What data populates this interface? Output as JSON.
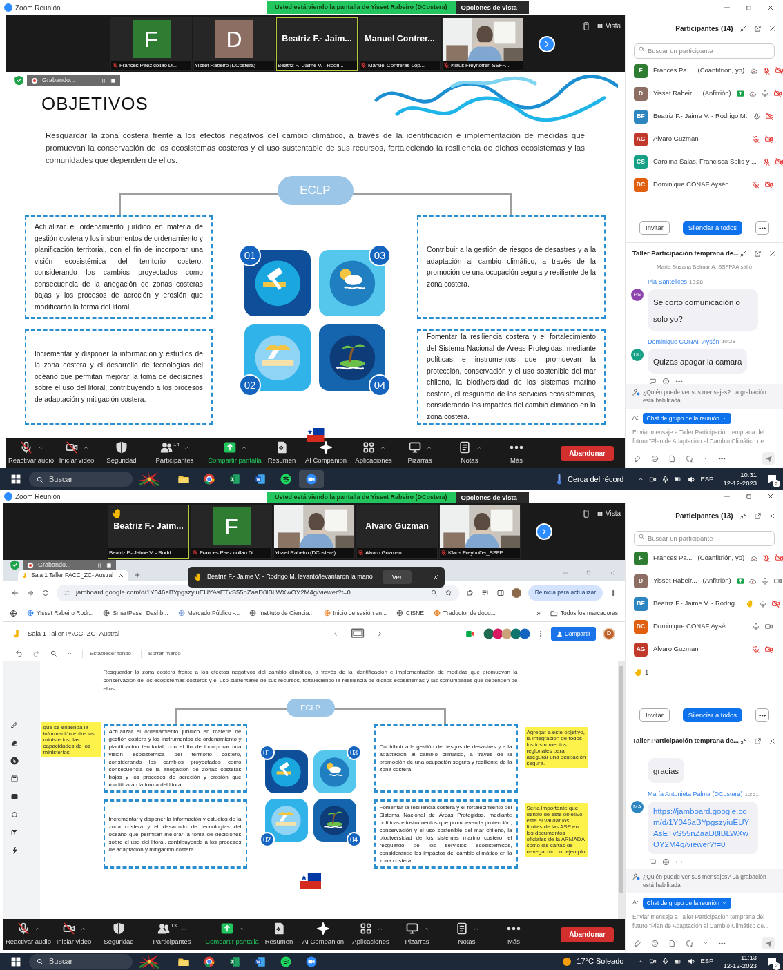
{
  "screens": [
    {
      "window": {
        "title": "Zoom Reunión"
      },
      "share_banner": {
        "text": "Usted está viendo la pantalla de Yisset Rabeiro (DCostera)",
        "view_options": "Opciones de vista"
      },
      "view_button": "Vista",
      "video_tiles": [
        {
          "kind": "avatar",
          "letter": "F",
          "color": "#2e7d32",
          "caption": "Frances Paez collao Di...",
          "muted": true,
          "active": false,
          "hand": false
        },
        {
          "kind": "avatar",
          "letter": "D",
          "color": "#8d6e63",
          "caption": "Yisset Rabeiro (DCostera)",
          "muted": false,
          "active": false,
          "hand": false
        },
        {
          "kind": "name",
          "name": "Beatriz F.- Jaim...",
          "caption": "Beatriz F.- Jaime V. - Rodri...",
          "muted": false,
          "active": true,
          "hand": false
        },
        {
          "kind": "name",
          "name": "Manuel Contrer...",
          "caption": "Manuel Contreras-Lop...",
          "muted": true,
          "active": false,
          "hand": false
        },
        {
          "kind": "video",
          "caption": "Klaus Freyhoffer_SSFF...",
          "muted": true,
          "active": false,
          "hand": false
        }
      ],
      "recording": {
        "label": "Grabando..."
      },
      "content": {
        "kind": "slide",
        "slide": {
          "heading": "OBJETIVOS",
          "intro": "Resguardar la zona costera frente a los efectos negativos del cambio climático, a través de la identificación e implementación de medidas que promuevan la conservación de los ecosistemas costeros y el uso sustentable de sus recursos, fortaleciendo la resiliencia de dichos ecosistemas y las comunidades que dependen de ellos.",
          "center_label": "ECLP",
          "objectives": [
            "Actualizar el ordenamiento jurídico en materia de gestión costera y los instrumentos de ordenamiento y planificación territorial, con el fin de incorporar una visión ecosistémica del territorio costero, considerando los cambios proyectados como consecuencia de la anegación de zonas costeras bajas y los procesos de acreción y erosión que modificarán la forma del litoral.",
            "Contribuir a la gestión de riesgos de desastres y a la adaptación al cambio climático, a través de la promoción de una ocupación segura y resiliente de la zona costera.",
            "Incrementar y disponer la información y estudios de la zona costera y el desarrollo de tecnologías del océano que permitan mejorar la toma de decisiones sobre el uso del litoral, contribuyendo a los procesos de adaptación y mitigación costera.",
            "Fomentar la resiliencia costera y el fortalecimiento del Sistema Nacional de Áreas Protegidas, mediante políticas e instrumentos que promuevan la protección, conservación y el uso sostenible del mar chileno, la biodiversidad de los sistemas marino costero, el resguardo de los servicios ecosistémicos, considerando los impactos del cambio climático en la zona costera."
          ],
          "tile_numbers": [
            "01",
            "03",
            "02",
            "04"
          ]
        }
      },
      "participants": {
        "title": "Participantes (14)",
        "search": {
          "placeholder": "Buscar un participante"
        },
        "items": [
          {
            "initials": "F",
            "color": "#2e7d32",
            "name": "Frances Pa...",
            "role": "(Coanfitrión, yo)",
            "sharing": false,
            "recording": true,
            "hand": false,
            "muted": true,
            "video_off": true
          },
          {
            "initials": "D",
            "color": "#8d6e63",
            "name": "Yisset Rabeir...",
            "role": "(Anfitrión)",
            "sharing": true,
            "recording": true,
            "hand": false,
            "muted": false,
            "video_off": true
          },
          {
            "initials": "BF",
            "color": "#2e86c1",
            "name": "Beatriz F.- Jaime V. - Rodrigo M.",
            "sharing": false,
            "recording": false,
            "hand": false,
            "muted": false,
            "video_off": true
          },
          {
            "initials": "AG",
            "color": "#c0392b",
            "name": "Alvaro Guzman",
            "sharing": false,
            "recording": false,
            "hand": false,
            "muted": true,
            "video_off": true
          },
          {
            "initials": "CS",
            "color": "#16a085",
            "name": "Carolina Salas, Francisca Solís y ...",
            "sharing": false,
            "recording": false,
            "hand": false,
            "muted": true,
            "video_off": true
          },
          {
            "initials": "DC",
            "color": "#e06010",
            "name": "Dominique CONAF Aysén",
            "sharing": false,
            "recording": false,
            "hand": false,
            "muted": true,
            "video_off": true
          }
        ],
        "invite": "Invitar",
        "mute_all": "Silenciar a todos"
      },
      "chat": {
        "title": "Taller Participación temprana de...",
        "messages": [
          {
            "kind": "system",
            "text": "María Susana Belmar A. SSFFAA salió"
          },
          {
            "kind": "text",
            "sender": "Pia Santelices",
            "initials": "PS",
            "color": "#8e44ad",
            "time": "10:28",
            "text": "Se corto comunicación o solo yo?"
          },
          {
            "kind": "text",
            "sender": "Dominique CONAF Aysén",
            "initials": "DC",
            "color": "#16a085",
            "time": "10:28",
            "text": "Quizas apagar la camara"
          }
        ],
        "notice": "¿Quién puede ver sus mensajes? La grabación está habilitada",
        "to_label": "A:",
        "recipient": "Chat de grupo de la reunión",
        "input": {
          "placeholder": "Enviar mensaje a Taller Participación temprana del futuro \"Plan de Adaptación al Cambio Climático de..."
        }
      },
      "toolbar": {
        "items": [
          {
            "kind": "audio",
            "label": "Reactivar audio",
            "off": true,
            "caret": true
          },
          {
            "kind": "video",
            "label": "Iniciar video",
            "off": true,
            "caret": true
          },
          {
            "kind": "security",
            "label": "Seguridad",
            "caret": false
          },
          {
            "kind": "participants",
            "label": "Participantes",
            "count": "14",
            "caret": true
          },
          {
            "kind": "share",
            "label": "Compartir pantalla",
            "caret": true
          },
          {
            "kind": "summary",
            "label": "Resumen",
            "caret": false
          },
          {
            "kind": "ai",
            "label": "AI Companion",
            "caret": false
          },
          {
            "kind": "apps",
            "label": "Aplicaciones",
            "caret": true
          },
          {
            "kind": "whiteboard",
            "label": "Pizarras",
            "caret": true
          },
          {
            "kind": "notes",
            "label": "Notas",
            "caret": true
          },
          {
            "kind": "more",
            "label": "Más",
            "caret": false
          }
        ],
        "leave": "Abandonar"
      },
      "taskbar": {
        "search": "Buscar",
        "apps": [
          {
            "kind": "explorer",
            "active": false
          },
          {
            "kind": "chrome",
            "active": false
          },
          {
            "kind": "excel",
            "active": false
          },
          {
            "kind": "word",
            "active": false
          },
          {
            "kind": "spotify",
            "active": false
          },
          {
            "kind": "zoom",
            "active": true
          }
        ],
        "weather": {
          "kind": "thermometer",
          "text": "Cerca del récord"
        },
        "language": "ESP",
        "time": "10:31",
        "date": "12-12-2023",
        "notifications": "2"
      }
    },
    {
      "window": {
        "title": "Zoom Reunión"
      },
      "share_banner": {
        "text": "Usted está viendo la pantalla de Yisset Rabeiro (DCostera)",
        "view_options": "Opciones de vista"
      },
      "view_button": "Vista",
      "video_tiles": [
        {
          "kind": "name",
          "name": "Beatriz F.- Jaim...",
          "caption": "Beatriz F.- Jaime V. - Rodri...",
          "muted": false,
          "active": true,
          "hand": true
        },
        {
          "kind": "avatar",
          "letter": "F",
          "color": "#2e7d32",
          "caption": "Frances Paez collao Di...",
          "muted": true,
          "active": false,
          "hand": false
        },
        {
          "kind": "video",
          "caption": "Yisset Rabeiro (DCostera)",
          "muted": false,
          "active": false,
          "hand": false
        },
        {
          "kind": "name",
          "name": "Alvaro Guzman",
          "caption": "Alvaro Guzman",
          "muted": true,
          "active": false,
          "hand": false
        },
        {
          "kind": "video",
          "caption": "Klaus Freyhoffer_SSFF...",
          "muted": true,
          "active": false,
          "hand": false
        }
      ],
      "recording": {
        "label": "Grabando..."
      },
      "content": {
        "kind": "browser",
        "tabs": [
          {
            "label": "Sala 1 Taller PACC_ZC- Austral",
            "selected": true
          }
        ],
        "notification": {
          "text": "Beatriz F.- Jaime V. - Rodrigo M. levantó/levantaron la mano",
          "action": "Ver"
        },
        "address": "jamboard.google.com/d/1Y046aBYpgszyiuEUYAsETvS55nZaaD8lBLWXwOY2M4g/viewer?f=0",
        "update_button": "Reinicia para actualizar",
        "bookmarks": [
          "Yisset Rabeiro Rodr...",
          "SmartPass | Dashb...",
          "Mercado Público -...",
          "Instituto de Ciencia...",
          "Inicio de sesión en...",
          "CISNE",
          "Traductor de docu..."
        ],
        "bookmarks_overflow": "»",
        "all_bookmarks": "Todos los marcadores",
        "jamboard": {
          "title": "Sala 1 Taller PACC_ZC- Austral",
          "share_button": "Compartir",
          "account": "D",
          "tools": [
            "Establecer fondo",
            "Borrar marco"
          ]
        },
        "slide": {
          "intro": "Resguardar la zona costera frente a los efectos negativos del cambio climático, a través de la identificación e implementación de medidas que promuevan la conservación de los ecosistemas costeros y el uso sustentable de sus recursos, fortaleciendo la resiliencia de dichos ecosistemas y las comunidades que dependen de ellos.",
          "center_label": "ECLP",
          "objectives": [
            "Actualizar el ordenamiento jurídico en materia de gestión costera y los instrumentos de ordenamiento y planificación territorial, con el fin de incorporar una visión ecosistémica del territorio costero, considerando los cambios proyectados como consecuencia de la anegación de zonas costeras bajas y los procesos de acreción y erosión que modificarán la forma del litoral.",
            "Contribuir a la gestión de riesgos de desastres y a la adaptación al cambio climático, a través de la promoción de una ocupación segura y resiliente de la zona costera.",
            "Incrementar y disponer la información y estudios de la zona costera y el desarrollo de tecnologías del océano que permitan mejorar la toma de decisiones sobre el uso del litoral, contribuyendo a los procesos de adaptación y mitigación costera.",
            "Fomentar la resiliencia costera y el fortalecimiento del Sistema Nacional de Áreas Protegidas, mediante políticas e instrumentos que promuevan la protección, conservación y el uso sostenible del mar chileno, la biodiversidad de los sistemas marino costero, el resguardo de los servicios ecosistémicos, considerando los impactos del cambio climático en la zona costera."
          ],
          "tile_numbers": [
            "01",
            "03",
            "02",
            "04"
          ]
        },
        "sticky_notes": [
          {
            "text": "que se entienda la información entre los ministerios, las capacidades de los ministerios"
          },
          {
            "text": "Agregar a este objetivo, la integración de todos los instrumentos regionales para asegurar una ocupación segura."
          },
          {
            "text": "Sería importante que, dentro de este objetivo esté el validar los límites de las ASP en los documentos oficiales de la ARMADA como las cartas de navegación por ejemplo"
          }
        ]
      },
      "participants": {
        "title": "Participantes (13)",
        "search": {
          "placeholder": "Buscar un participante"
        },
        "items": [
          {
            "initials": "F",
            "color": "#2e7d32",
            "name": "Frances Pa...",
            "role": "(Coanfitrión, yo)",
            "sharing": false,
            "recording": true,
            "hand": false,
            "muted": true,
            "video_off": true
          },
          {
            "initials": "D",
            "color": "#8d6e63",
            "name": "Yisset Rabeir...",
            "role": "(Anfitrión)",
            "sharing": true,
            "recording": true,
            "hand": false,
            "muted": false,
            "video_off": false
          },
          {
            "initials": "BF",
            "color": "#2e86c1",
            "name": "Beatriz F.- Jaime V. - Rodrig...",
            "sharing": false,
            "recording": false,
            "hand": true,
            "muted": false,
            "video_off": true
          },
          {
            "initials": "DC",
            "color": "#e06010",
            "name": "Dominique CONAF Aysén",
            "sharing": false,
            "recording": false,
            "hand": false,
            "muted": false,
            "video_off": false
          },
          {
            "initials": "AG",
            "color": "#c0392b",
            "name": "Alvaro Guzman",
            "sharing": false,
            "recording": false,
            "hand": false,
            "muted": true,
            "video_off": true
          }
        ],
        "raised_hands": "1",
        "invite": "Invitar",
        "mute_all": "Silenciar a todos"
      },
      "chat": {
        "title": "Taller Participación temprana de...",
        "messages": [
          {
            "kind": "text",
            "text": "gracias"
          },
          {
            "kind": "link",
            "sender": "María Antonieta Palma (DCostera)",
            "initials": "MA",
            "color": "#2e86c1",
            "time": "10:51",
            "text": "https://jamboard.google.com/d/1Y046aBYpgszyiuEUYAsETvS55nZaaD8lBLWXwOY2M4g/viewer?f=0"
          }
        ],
        "notice": "¿Quién puede ver sus mensajes? La grabación está habilitada",
        "to_label": "A:",
        "recipient": "Chat de grupo de la reunión",
        "input": {
          "placeholder": "Enviar mensaje a Taller Participación temprana del futuro \"Plan de Adaptación al Cambio Climático de..."
        }
      },
      "toolbar": {
        "items": [
          {
            "kind": "audio",
            "label": "Reactivar audio",
            "off": true,
            "caret": true
          },
          {
            "kind": "video",
            "label": "Iniciar video",
            "off": true,
            "caret": true
          },
          {
            "kind": "security",
            "label": "Seguridad",
            "caret": false
          },
          {
            "kind": "participants",
            "label": "Participantes",
            "count": "13",
            "caret": true
          },
          {
            "kind": "share",
            "label": "Compartir pantalla",
            "caret": true
          },
          {
            "kind": "summary",
            "label": "Resumen",
            "caret": false
          },
          {
            "kind": "ai",
            "label": "AI Companion",
            "caret": false
          },
          {
            "kind": "apps",
            "label": "Aplicaciones",
            "caret": true
          },
          {
            "kind": "whiteboard",
            "label": "Pizarras",
            "caret": true
          },
          {
            "kind": "notes",
            "label": "Notas",
            "caret": true
          },
          {
            "kind": "more",
            "label": "Más",
            "caret": false
          }
        ],
        "leave": "Abandonar"
      },
      "taskbar": {
        "search": "Buscar",
        "apps": [
          {
            "kind": "explorer",
            "active": false
          },
          {
            "kind": "chrome",
            "active": false
          },
          {
            "kind": "excel",
            "active": false
          },
          {
            "kind": "word",
            "active": false
          },
          {
            "kind": "spotify",
            "active": false
          },
          {
            "kind": "zoom",
            "active": false
          }
        ],
        "weather": {
          "kind": "sun",
          "text": "17°C Soleado"
        },
        "language": "ESP",
        "time": "11:13",
        "date": "12-12-2023",
        "notifications": "2"
      }
    }
  ]
}
